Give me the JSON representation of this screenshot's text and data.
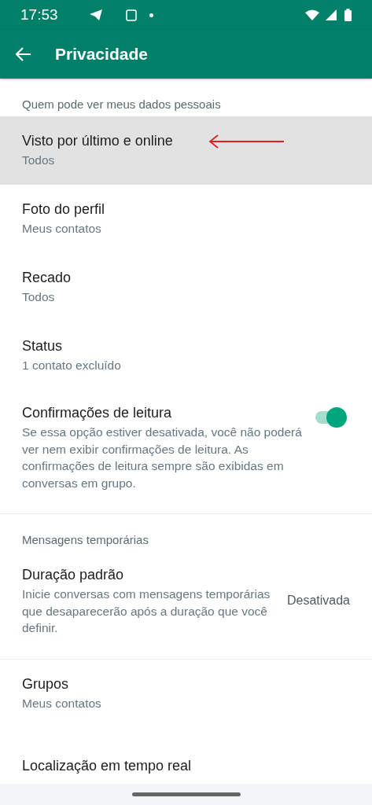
{
  "status_bar": {
    "time": "17:53"
  },
  "toolbar": {
    "title": "Privacidade"
  },
  "sections": [
    {
      "header": "Quem pode ver meus dados pessoais",
      "items": [
        {
          "kind": "nav",
          "title": "Visto por último e online",
          "subtitle": "Todos",
          "selected": true
        },
        {
          "kind": "nav",
          "title": "Foto do perfil",
          "subtitle": "Meus contatos",
          "selected": false
        },
        {
          "kind": "nav",
          "title": "Recado",
          "subtitle": "Todos",
          "selected": false
        },
        {
          "kind": "nav",
          "title": "Status",
          "subtitle": "1 contato excluído",
          "selected": false
        },
        {
          "kind": "toggle",
          "title": "Confirmações de leitura",
          "subtitle": "Se essa opção estiver desativada, você não poderá ver nem exibir confirmações de leitura. As confirmações de leitura sempre são exibidas em conversas em grupo.",
          "on": true,
          "selected": false
        }
      ]
    },
    {
      "header": "Mensagens temporárias",
      "items": [
        {
          "kind": "value",
          "title": "Duração padrão",
          "subtitle": "Inicie conversas com mensagens temporárias que desaparecerão após a duração que você definir.",
          "value": "Desativada",
          "selected": false
        }
      ]
    },
    {
      "items": [
        {
          "kind": "nav",
          "title": "Grupos",
          "subtitle": "Meus contatos",
          "selected": false
        },
        {
          "kind": "nav",
          "title": "Localização em tempo real",
          "selected": false
        }
      ]
    }
  ]
}
